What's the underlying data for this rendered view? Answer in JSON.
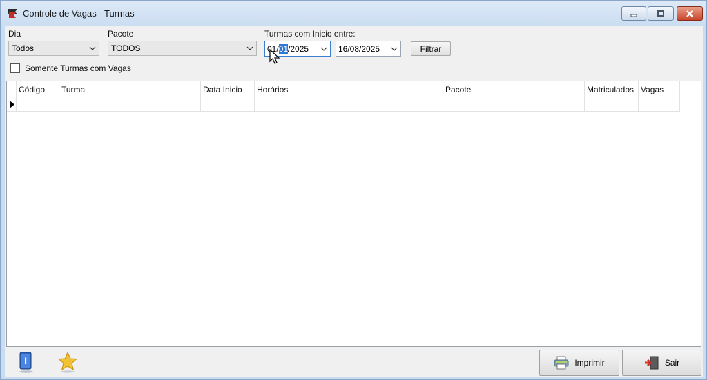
{
  "window": {
    "title": "Controle de Vagas - Turmas"
  },
  "filters": {
    "dia_label": "Dia",
    "dia_value": "Todos",
    "pacote_label": "Pacote",
    "pacote_value": "TODOS",
    "turmas_label": "Turmas com Inicio entre:",
    "date_start_prefix": "01/",
    "date_start_selected": "01",
    "date_start_suffix": "/2025",
    "date_end": "16/08/2025",
    "filter_button": "Filtrar",
    "only_vacancies_label": "Somente Turmas com Vagas",
    "only_vacancies_checked": false
  },
  "grid": {
    "columns": [
      "Código",
      "Turma",
      "Data Inicio",
      "Horários",
      "Pacote",
      "Matriculados",
      "Vagas"
    ]
  },
  "footer": {
    "help_icon": "book-help-icon",
    "favorite_icon": "star-icon",
    "print_button": "Imprimir",
    "exit_button": "Sair"
  },
  "colors": {
    "selection": "#3178d6",
    "close_button": "#c8462b",
    "titlebar": "#dde9f7"
  }
}
